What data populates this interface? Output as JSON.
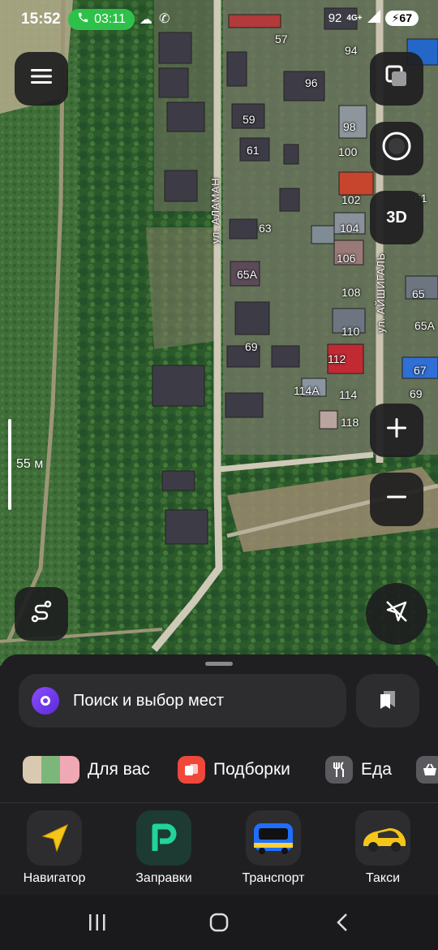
{
  "status_bar": {
    "time": "15:52",
    "call_timer": "03:11",
    "signal_number": "92",
    "network": "4G+",
    "battery": "67"
  },
  "map": {
    "house_numbers": [
      {
        "label": "57"
      },
      {
        "label": "94"
      },
      {
        "label": "96"
      },
      {
        "label": "59"
      },
      {
        "label": "98"
      },
      {
        "label": "61"
      },
      {
        "label": "100"
      },
      {
        "label": "102"
      },
      {
        "label": "61"
      },
      {
        "label": "63"
      },
      {
        "label": "104"
      },
      {
        "label": "106"
      },
      {
        "label": "65А"
      },
      {
        "label": "108"
      },
      {
        "label": "65"
      },
      {
        "label": "110"
      },
      {
        "label": "65А"
      },
      {
        "label": "69"
      },
      {
        "label": "112"
      },
      {
        "label": "67"
      },
      {
        "label": "114А"
      },
      {
        "label": "114"
      },
      {
        "label": "69"
      },
      {
        "label": "118"
      }
    ],
    "streets": [
      {
        "name": "ул. АЛАМАН"
      },
      {
        "name": "ул. АЙШИГАЛЬ"
      }
    ],
    "scale_label": "55 м",
    "button_3d_label": "3D"
  },
  "search": {
    "placeholder": "Поиск и выбор мест"
  },
  "chips": [
    {
      "label": "Для вас",
      "icon": "for-you-icon"
    },
    {
      "label": "Подборки",
      "icon": "collections-icon"
    },
    {
      "label": "Еда",
      "icon": "fork-knife-icon"
    },
    {
      "label": "",
      "icon": "basket-icon"
    }
  ],
  "apps": [
    {
      "label": "Навигатор",
      "icon": "navigator-arrow-icon"
    },
    {
      "label": "Заправки",
      "icon": "fuel-p-icon"
    },
    {
      "label": "Транспорт",
      "icon": "bus-icon"
    },
    {
      "label": "Такси",
      "icon": "taxi-car-icon"
    }
  ],
  "colors": {
    "accent_alice": "#6b3ce6",
    "call_green": "#2ec14a",
    "navigator_yellow": "#f5c518",
    "fuel_green": "#22d39a",
    "transport_blue": "#1f6fff",
    "chip_red": "#f0473b"
  }
}
